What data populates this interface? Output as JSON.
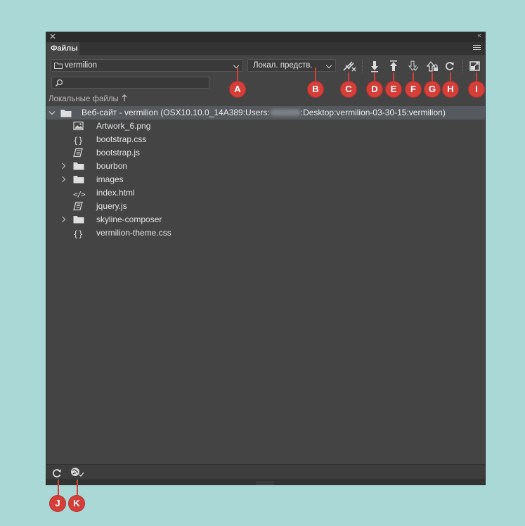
{
  "panel": {
    "tab_label": "Файлы",
    "close_glyph": "✕",
    "collapse_glyph": "‹‹"
  },
  "toolbar": {
    "site_select_value": "vermilion",
    "view_select_value": "Локал. предств."
  },
  "search": {
    "placeholder": ""
  },
  "local_files_header": "Локальные файлы",
  "root": {
    "label_prefix": "Веб-сайт - vermilion (OSX10.10.0_14A389:Users:",
    "label_suffix": ":Desktop:vermilion-03-30-15:vermilion)"
  },
  "files": [
    {
      "name": "Artwork_6.png",
      "icon": "image-icon"
    },
    {
      "name": "bootstrap.css",
      "icon": "css-braces-icon"
    },
    {
      "name": "bootstrap.js",
      "icon": "js-scroll-icon"
    },
    {
      "name": "bourbon",
      "icon": "folder-icon"
    },
    {
      "name": "images",
      "icon": "folder-icon"
    },
    {
      "name": "index.html",
      "icon": "html-tag-icon"
    },
    {
      "name": "jquery.js",
      "icon": "js-scroll-icon"
    },
    {
      "name": "skyline-composer",
      "icon": "folder-icon"
    },
    {
      "name": "vermilion-theme.css",
      "icon": "css-braces-icon"
    }
  ],
  "callouts": {
    "A": "A",
    "B": "B",
    "C": "C",
    "D": "D",
    "E": "E",
    "F": "F",
    "G": "G",
    "H": "H",
    "I": "I",
    "J": "J",
    "K": "K"
  },
  "colors": {
    "callout": "#d43f3a",
    "panel_bg": "#444444",
    "page_bg": "#a9d8d6",
    "selected_row": "#56595d"
  }
}
